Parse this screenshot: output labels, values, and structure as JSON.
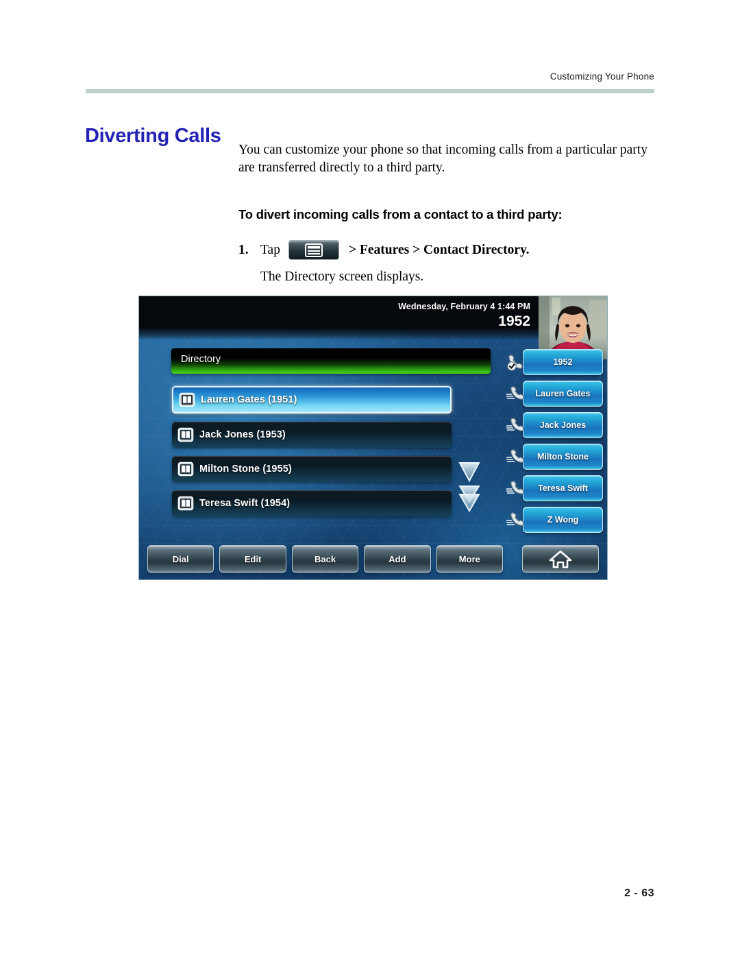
{
  "page": {
    "running_header": "Customizing Your Phone",
    "title": "Diverting Calls",
    "page_number": "2 - 63",
    "rule_color": "#bdd0cc",
    "title_color": "#2222b4"
  },
  "body": {
    "intro": "You can customize your phone so that incoming calls from a particular party are transferred directly to a third party.",
    "subhead": "To divert incoming calls from a contact to a third party:",
    "step": {
      "number": "1.",
      "lead_word": "Tap",
      "menu_key_icon": "menu-window-icon",
      "tail": "> Features > Contact Directory.",
      "result": "The Directory screen displays."
    }
  },
  "phone": {
    "status_bar": {
      "datetime": "Wednesday, February 4  1:44 PM",
      "extension": "1952"
    },
    "avatar_alt": "contact-photo",
    "screen_title": "Directory",
    "contacts": [
      {
        "label": "Lauren Gates (1951)",
        "icon": "contact-book-icon",
        "selected": true
      },
      {
        "label": "Jack Jones (1953)",
        "icon": "contact-book-icon",
        "selected": false
      },
      {
        "label": "Milton Stone (1955)",
        "icon": "contact-book-icon",
        "selected": false
      },
      {
        "label": "Teresa Swift (1954)",
        "icon": "contact-book-icon",
        "selected": false
      }
    ],
    "scroll_indicators": [
      "scroll-down-icon",
      "scroll-page-down-icon"
    ],
    "line_keys": [
      {
        "label": "1952",
        "icon": "handset-registered-icon"
      },
      {
        "label": "Lauren Gates",
        "icon": "handset-icon"
      },
      {
        "label": "Jack Jones",
        "icon": "handset-icon"
      },
      {
        "label": "Milton Stone",
        "icon": "handset-icon"
      },
      {
        "label": "Teresa Swift",
        "icon": "handset-icon"
      },
      {
        "label": "Z Wong",
        "icon": "handset-icon"
      }
    ],
    "soft_keys": [
      {
        "label": "Dial"
      },
      {
        "label": "Edit"
      },
      {
        "label": "Back"
      },
      {
        "label": "Add"
      },
      {
        "label": "More"
      }
    ],
    "home_key_icon": "home-icon"
  }
}
